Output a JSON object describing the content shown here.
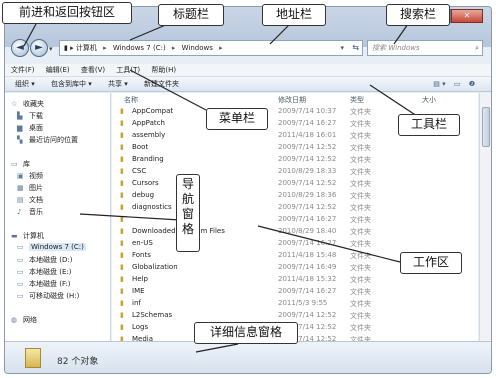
{
  "window": {
    "controls": {
      "minimize": "–",
      "maximize": "□",
      "close": "✕"
    }
  },
  "address_row": {
    "back": "◄",
    "forward": "►",
    "breadcrumb": [
      "计算机",
      "Windows 7 (C:)",
      "Windows"
    ],
    "search_placeholder": "搜索 Windows"
  },
  "menu": [
    "文件(F)",
    "编辑(E)",
    "查看(V)",
    "工具(T)",
    "帮助(H)"
  ],
  "toolbar": [
    "组织 ▾",
    "包含到库中 ▾",
    "共享 ▾",
    "新建文件夹"
  ],
  "nav_pane": {
    "favorites": [
      "收藏夹",
      "下载",
      "桌面",
      "最近访问的位置"
    ],
    "libraries": [
      "库",
      "视频",
      "图片",
      "文档",
      "音乐"
    ],
    "computer": [
      "计算机",
      "Windows 7 (C:)",
      "本地磁盘 (D:)",
      "本地磁盘 (E:)",
      "本地磁盘 (F:)",
      "可移动磁盘 (H:)"
    ],
    "network": "网络"
  },
  "columns": [
    "名称",
    "修改日期",
    "类型",
    "大小"
  ],
  "files": [
    {
      "name": "AppCompat",
      "date": "2009/7/14 10:37",
      "type": "文件夹"
    },
    {
      "name": "AppPatch",
      "date": "2009/7/14 16:27",
      "type": "文件夹"
    },
    {
      "name": "assembly",
      "date": "2011/4/18 16:01",
      "type": "文件夹"
    },
    {
      "name": "Boot",
      "date": "2009/7/14 12:52",
      "type": "文件夹"
    },
    {
      "name": "Branding",
      "date": "2009/7/14 12:52",
      "type": "文件夹"
    },
    {
      "name": "CSC",
      "date": "2010/8/29 18:33",
      "type": "文件夹"
    },
    {
      "name": "Cursors",
      "date": "2009/7/14 12:52",
      "type": "文件夹"
    },
    {
      "name": "debug",
      "date": "2010/8/29 18:36",
      "type": "文件夹"
    },
    {
      "name": "diagnostics",
      "date": "2009/7/14 12:52",
      "type": "文件夹"
    },
    {
      "name": "",
      "date": "2009/7/14 16:27",
      "type": "文件夹"
    },
    {
      "name": "Downloaded Program Files",
      "date": "2010/8/29 18:40",
      "type": "文件夹"
    },
    {
      "name": "en-US",
      "date": "2009/7/14 16:27",
      "type": "文件夹"
    },
    {
      "name": "Fonts",
      "date": "2011/4/18 15:48",
      "type": "文件夹"
    },
    {
      "name": "Globalization",
      "date": "2009/7/14 16:49",
      "type": "文件夹"
    },
    {
      "name": "Help",
      "date": "2011/4/18 15:32",
      "type": "文件夹"
    },
    {
      "name": "IME",
      "date": "2009/7/14 16:27",
      "type": "文件夹"
    },
    {
      "name": "inf",
      "date": "2011/5/3 9:55",
      "type": "文件夹"
    },
    {
      "name": "L2Schemas",
      "date": "2009/7/14 12:52",
      "type": "文件夹"
    },
    {
      "name": "Logs",
      "date": "2009/7/14 12:52",
      "type": "文件夹"
    },
    {
      "name": "Media",
      "date": "2009/7/14 12:52",
      "type": "文件夹"
    }
  ],
  "details": {
    "count": "82 个对象"
  },
  "callouts": {
    "nav_buttons": "前进和返回按钮区",
    "titlebar": "标题栏",
    "addressbar": "地址栏",
    "searchbar": "搜索栏",
    "menubar": "菜单栏",
    "toolbar": "工具栏",
    "navpane": "导航窗格",
    "workarea": "工作区",
    "details": "详细信息窗格"
  }
}
